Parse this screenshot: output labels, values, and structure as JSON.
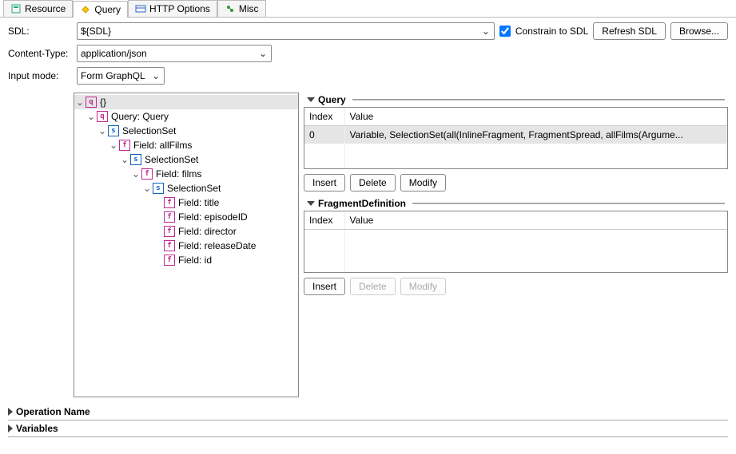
{
  "tabs": [
    {
      "label": "Resource",
      "active": false
    },
    {
      "label": "Query",
      "active": true
    },
    {
      "label": "HTTP Options",
      "active": false
    },
    {
      "label": "Misc",
      "active": false
    }
  ],
  "form": {
    "sdl_label": "SDL:",
    "sdl_value": "${SDL}",
    "constrain_label": "Constrain to SDL",
    "refresh_label": "Refresh SDL",
    "browse_label": "Browse...",
    "content_type_label": "Content-Type:",
    "content_type_value": "application/json",
    "input_mode_label": "Input mode:",
    "input_mode_value": "Form GraphQL"
  },
  "tree": {
    "root": {
      "badge": "q",
      "label": "{}"
    },
    "query": {
      "badge": "q",
      "label": "Query: Query"
    },
    "ss1": {
      "badge": "s",
      "label": "SelectionSet"
    },
    "allFilms": {
      "badge": "f",
      "label": "Field: allFilms"
    },
    "ss2": {
      "badge": "s",
      "label": "SelectionSet"
    },
    "films": {
      "badge": "f",
      "label": "Field: films"
    },
    "ss3": {
      "badge": "s",
      "label": "SelectionSet"
    },
    "leaves": [
      {
        "badge": "f",
        "label": "Field: title"
      },
      {
        "badge": "f",
        "label": "Field: episodeID"
      },
      {
        "badge": "f",
        "label": "Field: director"
      },
      {
        "badge": "f",
        "label": "Field: releaseDate"
      },
      {
        "badge": "f",
        "label": "Field: id"
      }
    ]
  },
  "query_section": {
    "title": "Query",
    "headers": {
      "index": "Index",
      "value": "Value"
    },
    "rows": [
      {
        "index": "0",
        "value": "Variable, SelectionSet(all(InlineFragment, FragmentSpread, allFilms(Argume..."
      }
    ],
    "buttons": {
      "insert": "Insert",
      "delete": "Delete",
      "modify": "Modify"
    }
  },
  "fragment_section": {
    "title": "FragmentDefinition",
    "headers": {
      "index": "Index",
      "value": "Value"
    },
    "buttons": {
      "insert": "Insert",
      "delete": "Delete",
      "modify": "Modify"
    }
  },
  "bottom": {
    "operation_name": "Operation Name",
    "variables": "Variables"
  }
}
